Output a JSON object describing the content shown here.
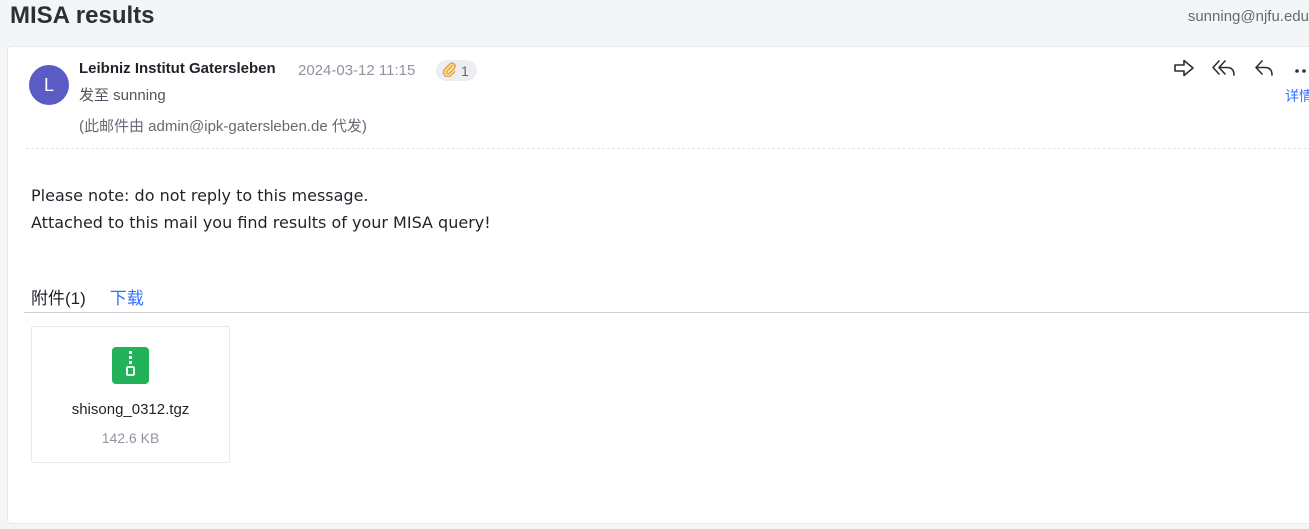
{
  "header": {
    "subject": "MISA results",
    "account": "sunning@njfu.edu"
  },
  "message": {
    "avatar_letter": "L",
    "sender": "Leibniz Institut Gatersleben",
    "date": "2024-03-12 11:15",
    "attachment_count": "1",
    "to_line": "发至 sunning",
    "via_line": "(此邮件由 admin@ipk-gatersleben.de 代发)",
    "details_label": "详情",
    "actions": [
      {
        "name": "forward",
        "icon": "forward-icon"
      },
      {
        "name": "reply-all",
        "icon": "reply-all-icon"
      },
      {
        "name": "reply",
        "icon": "reply-icon"
      },
      {
        "name": "more",
        "icon": "more-icon"
      }
    ],
    "body_lines": [
      "Please note: do not reply to this message.",
      "Attached to this mail you find results of your MISA query!"
    ]
  },
  "attachments": {
    "title": "附件(1)",
    "download_label": "下载",
    "files": [
      {
        "name": "shisong_0312.tgz",
        "size": "142.6 KB",
        "icon": "zip-file-icon"
      }
    ]
  },
  "colors": {
    "avatar": "#5a5bc5",
    "link": "#3370ff",
    "zip": "#22b35a",
    "badge_clip": "#f0a43a"
  }
}
